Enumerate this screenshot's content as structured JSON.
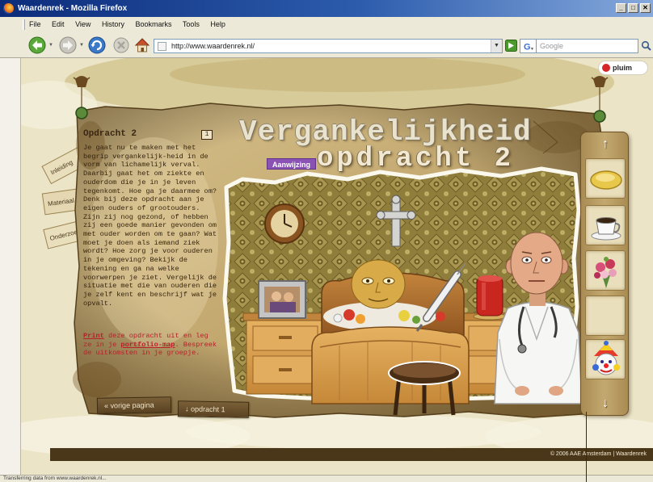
{
  "browser": {
    "title": "Waardenrek - Mozilla Firefox",
    "controls": {
      "minimize": "_",
      "maximize": "□",
      "close": "✕"
    },
    "menu": [
      "File",
      "Edit",
      "View",
      "History",
      "Bookmarks",
      "Tools",
      "Help"
    ],
    "toolbar_icons": [
      "back-arrow-icon",
      "forward-arrow-icon",
      "reload-icon",
      "stop-icon",
      "home-icon",
      "go-arrow-icon",
      "google-icon",
      "magnifier-icon"
    ],
    "url": "http://www.waardenrek.nl/",
    "url_dropdown": "▼",
    "search_placeholder": "Google",
    "status": "Transferring data from www.waardenrek.nl..."
  },
  "site": {
    "pluim_label": "pluim",
    "title": "Vergankelijkheid",
    "subtitle": "opdracht 2",
    "tag_label": "Aanwijzing",
    "side_tabs": [
      "Inleiding",
      "Materiaal",
      "Onderzoek"
    ],
    "assignment": {
      "heading": "Opdracht 2",
      "page_indicator": "1",
      "body": "Je gaat nu te maken met het begrip vergankelijk-heid in de vorm van lichamelijk verval. Daarbij gaat het om ziekte en ouderdom die je in je leven tegenkomt. Hoe ga je daarmee om? Denk bij deze opdracht aan je eigen ouders of grootouders. Zijn zij nog gezond, of hebben zij een goede manier gevonden om met ouder worden om te gaan? Wat moet je doen als iemand ziek wordt? Hoe zorg je voor ouderen in je omgeving? Bekijk de tekening en ga na welke voorwerpen je ziet. Vergelijk de situatie met die van ouderen die je zelf kent en beschrijf wat je opvalt.",
      "print_word": "Print",
      "print_text_1": " deze opdracht uit en leg ze in je ",
      "print_link": "portfolio-map",
      "print_text_2": ". Bespreek de uitkomsten in je groepje."
    },
    "nav_buttons": {
      "previous": "« vorige pagina",
      "next": "↓ opdracht 1"
    },
    "sidebar": {
      "up_label": "↑",
      "down_label": "↓",
      "items": [
        "soap-bar-icon",
        "coffee-cup-icon",
        "flower-bouquet-icon",
        "empty-slot",
        "clown-mask-icon"
      ]
    },
    "scene_items": [
      "wall-clock-icon",
      "crucifix-icon",
      "photo-frame-icon",
      "nightstand-icon",
      "bed-icon",
      "elderly-patient-icon",
      "red-candle-icon",
      "syringe-icon",
      "stool-icon",
      "doctor-icon"
    ],
    "footer": "© 2006 AAE Amsterdam | Waardenrek"
  },
  "colors": {
    "title_bar": "#0c2c7a",
    "chrome": "#ece9d8",
    "parchment": "#c9b07a",
    "wallpaper": "#8f7d3b",
    "tag": "#8a52b4",
    "link_red": "#b8202a",
    "footer_bar": "#4a3618",
    "pluim_dot": "#d6262a"
  }
}
